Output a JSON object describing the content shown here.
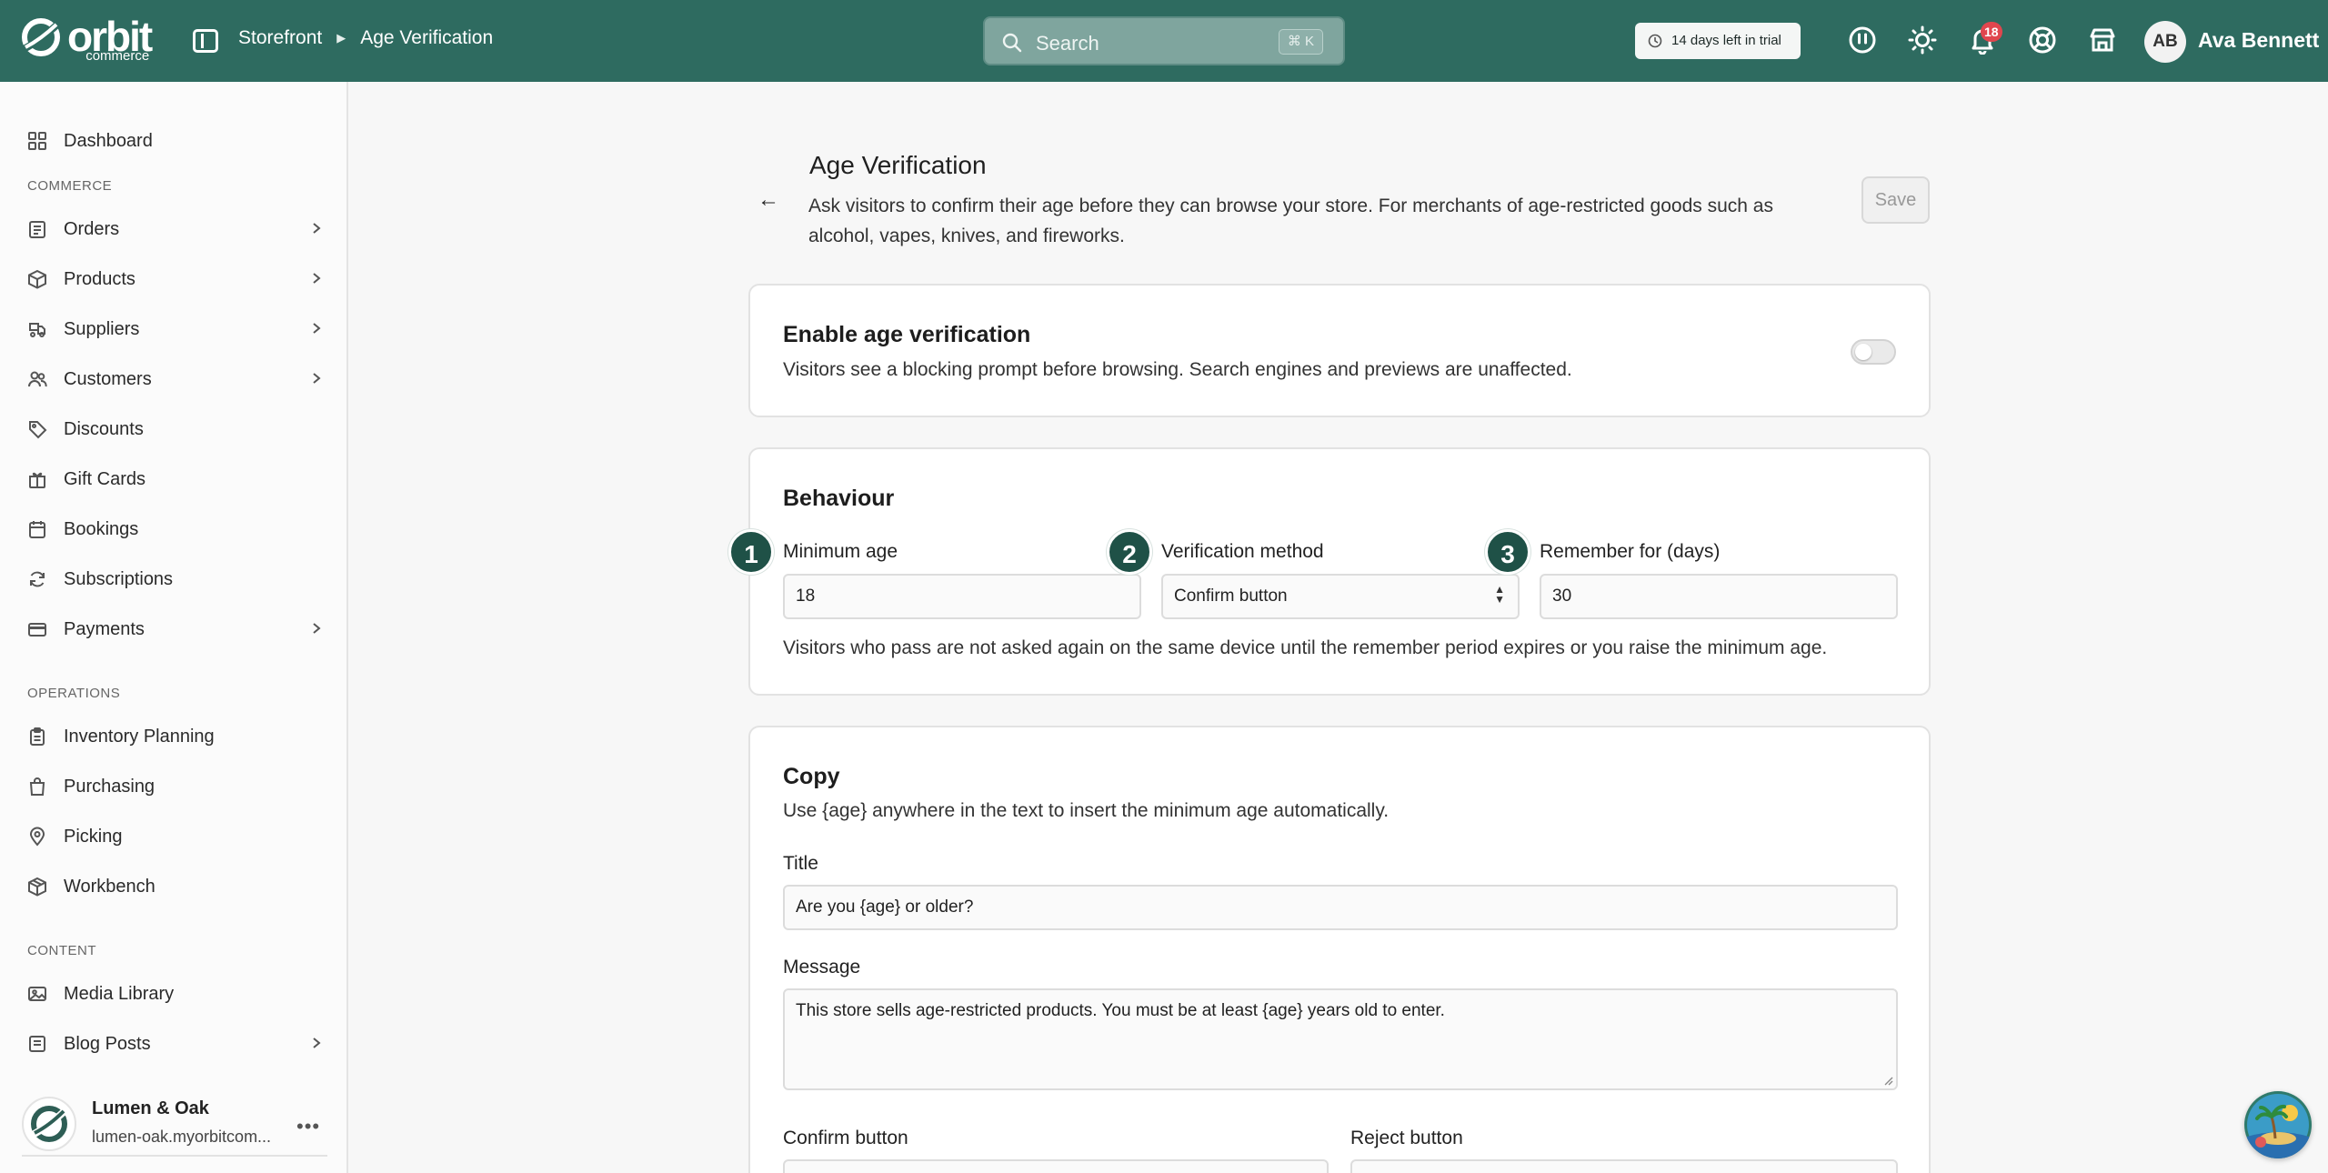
{
  "brand": {
    "name": "orbit",
    "sub": "commerce"
  },
  "breadcrumb": [
    "Storefront",
    "Age Verification"
  ],
  "search": {
    "placeholder": "Search",
    "shortcut": "⌘ K"
  },
  "trial": {
    "label": "14 days left in trial"
  },
  "topbar_icons": [
    "status-icon",
    "sun-icon",
    "bell-icon",
    "help-icon",
    "store-icon"
  ],
  "notifications": {
    "count": "18"
  },
  "user": {
    "initials": "AB",
    "name": "Ava Bennett"
  },
  "sidebar": {
    "dashboard": "Dashboard",
    "section_commerce": "COMMERCE",
    "orders": "Orders",
    "products": "Products",
    "suppliers": "Suppliers",
    "customers": "Customers",
    "discounts": "Discounts",
    "gift_cards": "Gift Cards",
    "bookings": "Bookings",
    "subscriptions": "Subscriptions",
    "payments": "Payments",
    "section_operations": "OPERATIONS",
    "inventory_planning": "Inventory Planning",
    "purchasing": "Purchasing",
    "picking": "Picking",
    "workbench": "Workbench",
    "section_content": "CONTENT",
    "media_library": "Media Library",
    "blog_posts": "Blog Posts"
  },
  "store": {
    "name": "Lumen & Oak",
    "url": "lumen-oak.myorbitcom..."
  },
  "page": {
    "title": "Age Verification",
    "description": "Ask visitors to confirm their age before they can browse your store. For merchants of age-restricted goods such as alcohol, vapes, knives, and fireworks.",
    "save_label": "Save"
  },
  "enable_card": {
    "title": "Enable age verification",
    "text": "Visitors see a blocking prompt before browsing. Search engines and previews are unaffected.",
    "enabled": false
  },
  "behaviour": {
    "title": "Behaviour",
    "steps": [
      "1",
      "2",
      "3"
    ],
    "min_age_label": "Minimum age",
    "min_age_value": "18",
    "method_label": "Verification method",
    "method_value": "Confirm button",
    "remember_label": "Remember for (days)",
    "remember_value": "30",
    "note": "Visitors who pass are not asked again on the same device until the remember period expires or you raise the minimum age."
  },
  "copy": {
    "title": "Copy",
    "hint": "Use {age} anywhere in the text to insert the minimum age automatically.",
    "title_label": "Title",
    "title_value": "Are you {age} or older?",
    "message_label": "Message",
    "message_value": "This store sells age-restricted products. You must be at least {age} years old to enter.",
    "confirm_label": "Confirm button",
    "reject_label": "Reject button"
  },
  "colors": {
    "topbar": "#2e6b60",
    "step_badge": "#1f5147",
    "badge": "#e0464e"
  }
}
